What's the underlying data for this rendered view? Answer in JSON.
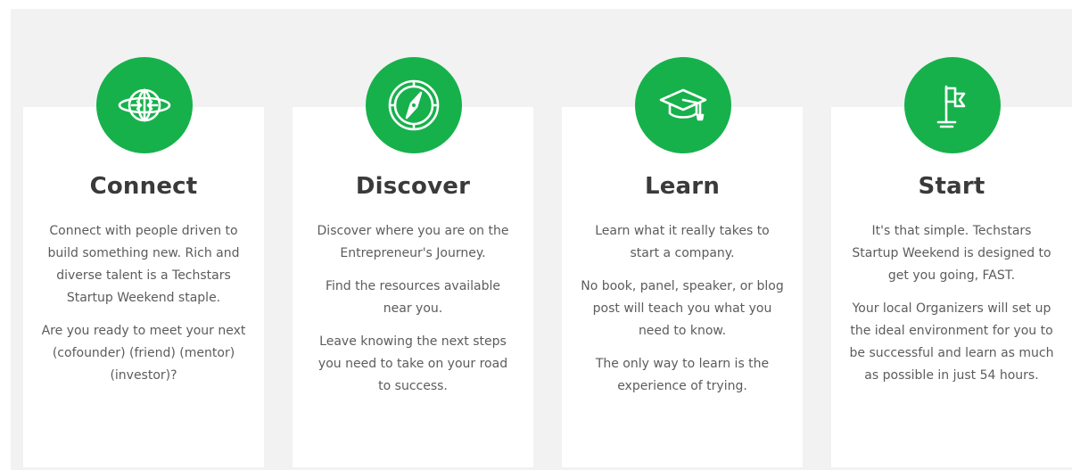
{
  "colors": {
    "accent": "#16b14b",
    "background": "#f2f2f2",
    "card": "#ffffff",
    "title": "#3a3a3a",
    "text": "#5c5c5c"
  },
  "cards": [
    {
      "icon": "globe-arrows-icon",
      "title": "Connect",
      "paragraphs": [
        "Connect with people driven to build something new. Rich and diverse talent is a Techstars Startup Weekend staple.",
        "Are you ready to meet your next (cofounder) (friend) (mentor) (investor)?"
      ]
    },
    {
      "icon": "compass-icon",
      "title": "Discover",
      "paragraphs": [
        "Discover where you are on the Entrepreneur's Journey.",
        "Find the resources available near you.",
        "Leave knowing the next steps you need to take on your road to success."
      ]
    },
    {
      "icon": "graduation-cap-icon",
      "title": "Learn",
      "paragraphs": [
        "Learn what it really takes to start a company.",
        "No book, panel, speaker, or blog post will teach you what you need to know.",
        "The only way to learn is the experience of trying."
      ]
    },
    {
      "icon": "flag-icon",
      "title": "Start",
      "paragraphs": [
        "It's that simple. Techstars Startup Weekend is designed to get you going, FAST.",
        "Your local Organizers will set up the ideal environment for you to be successful and learn as much as possible in just 54 hours."
      ]
    }
  ]
}
